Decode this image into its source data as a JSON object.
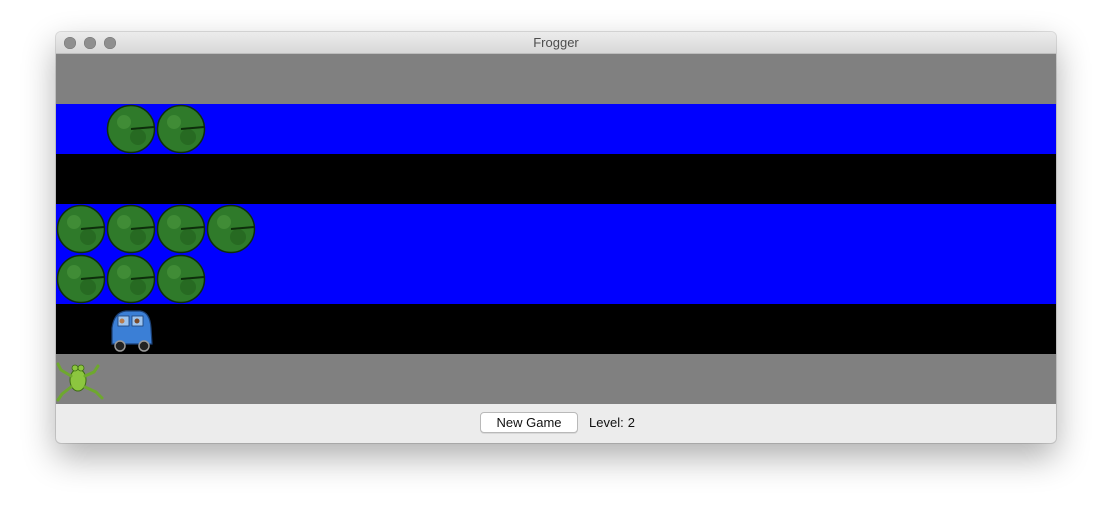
{
  "window": {
    "title": "Frogger"
  },
  "colors": {
    "grass": "#808080",
    "water": "#0000ff",
    "road": "#000000"
  },
  "board": {
    "lanes": [
      "grass",
      "water",
      "road",
      "water",
      "water",
      "road",
      "grass"
    ],
    "sprites": {
      "lily_pads": 9,
      "cars": 1,
      "frog": 1
    }
  },
  "controls": {
    "new_game_label": "New Game",
    "level_label": "Level:",
    "level_value": "2"
  }
}
